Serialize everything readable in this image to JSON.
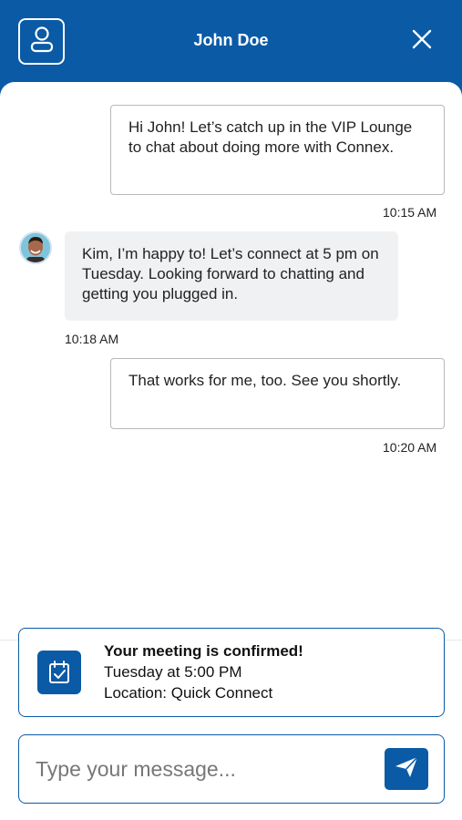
{
  "header": {
    "title": "John Doe",
    "profile_icon": "user-profile-icon",
    "close_icon": "close-icon",
    "brand_color": "#0a5aa6"
  },
  "messages": [
    {
      "direction": "outgoing",
      "text": "Hi John! Let’s catch up in the VIP Lounge to chat about doing more with Connex.",
      "time": "10:15 AM"
    },
    {
      "direction": "incoming",
      "text": "Kim, I’m happy to! Let’s connect at 5 pm on Tuesday. Looking forward to chatting and getting you plugged in.",
      "time": "10:18 AM"
    },
    {
      "direction": "outgoing",
      "text": "That works for me, too. See you shortly.",
      "time": "10:20 AM"
    }
  ],
  "confirmation": {
    "icon": "calendar-check-icon",
    "title": "Your meeting is confirmed!",
    "when": "Tuesday at 5:00 PM",
    "location": "Location: Quick Connect"
  },
  "composer": {
    "placeholder": "Type your message...",
    "value": "",
    "send_icon": "send-icon"
  }
}
